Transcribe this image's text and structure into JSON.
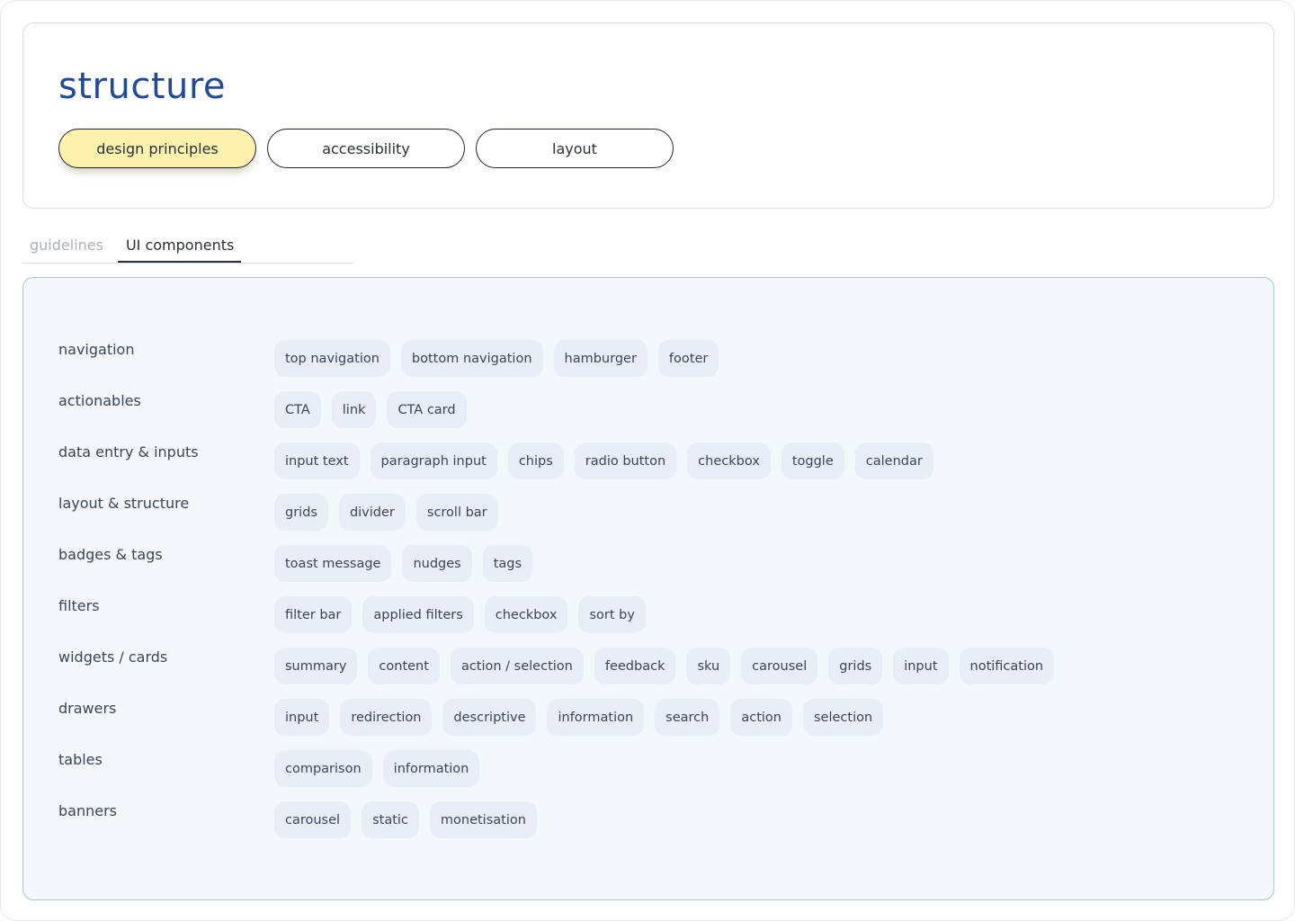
{
  "header": {
    "title": "structure",
    "pills": [
      {
        "label": "design principles",
        "active": true
      },
      {
        "label": "accessibility",
        "active": false
      },
      {
        "label": "layout",
        "active": false
      }
    ]
  },
  "tabs": [
    {
      "label": "guidelines",
      "active": false
    },
    {
      "label": "UI components",
      "active": true
    }
  ],
  "categories": [
    {
      "label": "navigation",
      "items": [
        "top navigation",
        "bottom navigation",
        "hamburger",
        "footer"
      ]
    },
    {
      "label": "actionables",
      "items": [
        "CTA",
        "link",
        "CTA card"
      ]
    },
    {
      "label": "data entry & inputs",
      "items": [
        "input text",
        "paragraph input",
        "chips",
        "radio button",
        "checkbox",
        "toggle",
        "calendar"
      ]
    },
    {
      "label": "layout & structure",
      "items": [
        "grids",
        "divider",
        "scroll bar"
      ]
    },
    {
      "label": "badges & tags",
      "items": [
        "toast message",
        "nudges",
        "tags"
      ]
    },
    {
      "label": "filters",
      "items": [
        "filter bar",
        "applied filters",
        "checkbox",
        "sort by"
      ]
    },
    {
      "label": "widgets / cards",
      "items": [
        "summary",
        "content",
        "action / selection",
        "feedback",
        "sku",
        "carousel",
        "grids",
        "input",
        "notification"
      ]
    },
    {
      "label": "drawers",
      "items": [
        "input",
        "redirection",
        "descriptive",
        "information",
        "search",
        "action",
        "selection"
      ]
    },
    {
      "label": "tables",
      "items": [
        "comparison",
        "information"
      ]
    },
    {
      "label": "banners",
      "items": [
        "carousel",
        "static",
        "monetisation"
      ]
    }
  ],
  "colors": {
    "title": "#1f4a9c",
    "active_pill": "#fcf2ad",
    "panel_bg": "#f4f8fd",
    "chip_bg": "#e9eef6"
  }
}
